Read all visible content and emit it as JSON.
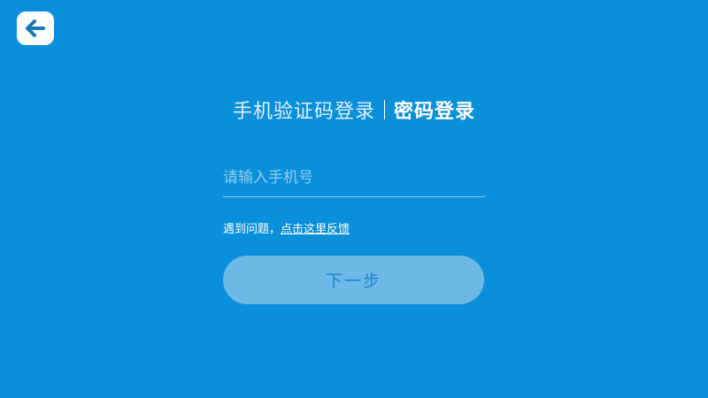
{
  "back_button": {
    "icon": "arrow-left-icon"
  },
  "tabs": [
    {
      "label": "手机验证码登录",
      "active": false
    },
    {
      "label": "密码登录",
      "active": true
    }
  ],
  "phone_input": {
    "placeholder": "请输入手机号",
    "value": ""
  },
  "help": {
    "prefix": "遇到问题，",
    "link_label": "点击这里反馈"
  },
  "next_button": {
    "label": "下一步"
  },
  "colors": {
    "background": "#0a8fdb",
    "button": "#6cb9e6",
    "button_text": "#1f86c9",
    "icon": "#1579b8"
  }
}
